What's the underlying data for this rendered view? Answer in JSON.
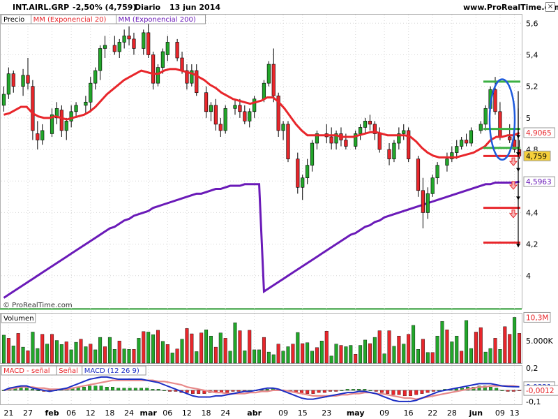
{
  "header": {
    "ticker": "INT.AIRL.GRP",
    "change": "-2,50% (4,759)",
    "period": "Diario",
    "date": "13 jun 2014",
    "site": "www.ProRealTime.com",
    "close_glyph": "×"
  },
  "watermark": "© ProRealTime.com",
  "colors": {
    "up": "#22a62a",
    "down": "#e8262b",
    "ema20": "#e8262b",
    "ema200": "#6a1ab8",
    "support": "#e8262b",
    "resistance": "#3cb043",
    "macd": "#1c2ec4",
    "signal": "#e88a8a",
    "ellipse": "#1e5adc",
    "grid": "#d6d6d6"
  },
  "chart_data": [
    {
      "type": "candlestick",
      "panel": "price",
      "legend": [
        "Precio",
        "MM (Exponencial 20)",
        "MM (Exponencial 200)"
      ],
      "y_ticks": [
        "5,6",
        "5,4",
        "5,2",
        "5",
        "4,8",
        "4,6",
        "4,4",
        "4,2",
        "4"
      ],
      "y_tick_values": [
        5.6,
        5.4,
        5.2,
        5.0,
        4.8,
        4.6,
        4.4,
        4.2,
        4.0
      ],
      "ylim": [
        3.8,
        5.65
      ],
      "x_ticks": [
        "21",
        "27",
        "feb",
        "06",
        "12",
        "18",
        "24",
        "mar",
        "06",
        "12",
        "18",
        "24",
        "abr",
        "09",
        "15",
        "23",
        "may",
        "09",
        "16",
        "22",
        "28",
        "jun",
        "09",
        "13"
      ],
      "x_tick_bars": [
        1,
        5,
        10,
        14,
        18,
        22,
        26,
        30,
        34,
        38,
        42,
        46,
        52,
        58,
        62,
        67,
        73,
        79,
        84,
        89,
        93,
        98,
        103,
        106
      ],
      "bars": 108,
      "candles_ohlc": [
        [
          5.08,
          5.2,
          5.04,
          5.15
        ],
        [
          5.15,
          5.32,
          5.12,
          5.28
        ],
        [
          5.28,
          5.3,
          5.16,
          5.2
        ],
        [
          5.2,
          5.31,
          5.14,
          5.27
        ],
        [
          5.27,
          5.38,
          5.18,
          5.22
        ],
        [
          5.2,
          5.24,
          4.86,
          4.92
        ],
        [
          4.9,
          4.98,
          4.8,
          4.86
        ],
        [
          4.86,
          4.96,
          4.83,
          4.92
        ],
        [
          4.9,
          5.06,
          4.88,
          5.02
        ],
        [
          5.0,
          5.1,
          4.96,
          5.06
        ],
        [
          5.05,
          5.08,
          4.88,
          4.92
        ],
        [
          4.92,
          5.0,
          4.86,
          4.98
        ],
        [
          4.98,
          5.08,
          4.94,
          5.04
        ],
        [
          5.04,
          5.1,
          5.0,
          5.08
        ],
        [
          5.08,
          5.14,
          5.02,
          5.1
        ],
        [
          5.1,
          5.26,
          5.04,
          5.22
        ],
        [
          5.22,
          5.32,
          5.18,
          5.3
        ],
        [
          5.3,
          5.46,
          5.24,
          5.44
        ],
        [
          5.44,
          5.52,
          5.38,
          5.46
        ],
        [
          5.46,
          5.52,
          5.4,
          5.42
        ],
        [
          5.42,
          5.5,
          5.38,
          5.48
        ],
        [
          5.48,
          5.56,
          5.44,
          5.52
        ],
        [
          5.52,
          5.58,
          5.46,
          5.5
        ],
        [
          5.5,
          5.54,
          5.4,
          5.44
        ],
        [
          5.44,
          5.56,
          5.4,
          5.54
        ],
        [
          5.54,
          5.6,
          5.38,
          5.4
        ],
        [
          5.4,
          5.42,
          5.18,
          5.22
        ],
        [
          5.22,
          5.34,
          5.2,
          5.32
        ],
        [
          5.32,
          5.44,
          5.28,
          5.42
        ],
        [
          5.4,
          5.52,
          5.36,
          5.48
        ],
        [
          5.48,
          5.5,
          5.36,
          5.38
        ],
        [
          5.38,
          5.42,
          5.28,
          5.3
        ],
        [
          5.3,
          5.34,
          5.18,
          5.22
        ],
        [
          5.22,
          5.34,
          5.2,
          5.3
        ],
        [
          5.3,
          5.34,
          5.14,
          5.16
        ],
        [
          5.16,
          5.2,
          5.0,
          5.04
        ],
        [
          5.04,
          5.1,
          4.98,
          5.08
        ],
        [
          5.08,
          5.12,
          4.92,
          4.96
        ],
        [
          4.96,
          5.0,
          4.88,
          4.92
        ],
        [
          4.92,
          5.08,
          4.9,
          5.06
        ],
        [
          5.06,
          5.12,
          5.02,
          5.08
        ],
        [
          5.08,
          5.12,
          5.0,
          5.04
        ],
        [
          5.04,
          5.08,
          4.96,
          4.98
        ],
        [
          4.98,
          5.06,
          4.94,
          5.04
        ],
        [
          5.04,
          5.14,
          5.0,
          5.12
        ],
        [
          5.12,
          5.24,
          5.1,
          5.22
        ],
        [
          5.22,
          5.36,
          5.2,
          5.34
        ],
        [
          5.34,
          5.44,
          5.1,
          5.14
        ],
        [
          5.14,
          5.16,
          4.88,
          4.92
        ],
        [
          4.92,
          4.98,
          4.86,
          4.96
        ],
        [
          4.96,
          4.98,
          4.72,
          4.74
        ],
        [
          4.74,
          4.78,
          4.52,
          4.56
        ],
        [
          4.56,
          4.64,
          4.48,
          4.62
        ],
        [
          4.62,
          4.74,
          4.58,
          4.7
        ],
        [
          4.7,
          4.86,
          4.66,
          4.84
        ],
        [
          4.84,
          4.92,
          4.8,
          4.9
        ],
        [
          4.9,
          4.96,
          4.84,
          4.88
        ],
        [
          4.88,
          4.94,
          4.8,
          4.84
        ],
        [
          4.84,
          4.92,
          4.8,
          4.9
        ],
        [
          4.9,
          4.94,
          4.82,
          4.86
        ],
        [
          4.86,
          4.9,
          4.8,
          4.82
        ],
        [
          4.82,
          4.92,
          4.8,
          4.9
        ],
        [
          4.9,
          4.96,
          4.86,
          4.94
        ],
        [
          4.94,
          5.0,
          4.9,
          4.98
        ],
        [
          4.98,
          5.02,
          4.92,
          4.96
        ],
        [
          4.96,
          4.98,
          4.86,
          4.9
        ],
        [
          4.9,
          4.94,
          4.78,
          4.8
        ],
        [
          4.8,
          4.84,
          4.7,
          4.74
        ],
        [
          4.74,
          4.86,
          4.72,
          4.84
        ],
        [
          4.84,
          4.94,
          4.8,
          4.9
        ],
        [
          4.9,
          4.96,
          4.86,
          4.92
        ],
        [
          4.92,
          4.94,
          4.72,
          4.74
        ],
        [
          4.74,
          4.76,
          4.5,
          4.54
        ],
        [
          4.54,
          4.62,
          4.3,
          4.4
        ],
        [
          4.4,
          4.56,
          4.36,
          4.52
        ],
        [
          4.52,
          4.64,
          4.5,
          4.62
        ],
        [
          4.62,
          4.72,
          4.58,
          4.7
        ],
        [
          4.7,
          4.78,
          4.66,
          4.74
        ],
        [
          4.74,
          4.82,
          4.72,
          4.78
        ],
        [
          4.78,
          4.86,
          4.74,
          4.82
        ],
        [
          4.82,
          4.88,
          4.8,
          4.86
        ],
        [
          4.86,
          4.9,
          4.82,
          4.84
        ],
        [
          4.84,
          4.94,
          4.82,
          4.92
        ],
        [
          4.92,
          4.98,
          4.9,
          4.96
        ],
        [
          4.96,
          5.08,
          4.92,
          5.06
        ],
        [
          5.06,
          5.2,
          5.04,
          5.18
        ],
        [
          5.18,
          5.26,
          5.02,
          5.04
        ],
        [
          5.04,
          5.1,
          4.86,
          4.88
        ],
        [
          4.88,
          4.96,
          4.84,
          4.86
        ],
        [
          4.86,
          4.92,
          4.78,
          4.8
        ],
        [
          4.8,
          4.86,
          4.74,
          4.76
        ]
      ],
      "ema20": [
        5.02,
        5.03,
        5.05,
        5.07,
        5.07,
        5.03,
        5.01,
        5.0,
        5.0,
        5.01,
        5.0,
        4.99,
        5.0,
        5.01,
        5.02,
        5.04,
        5.07,
        5.11,
        5.15,
        5.18,
        5.21,
        5.24,
        5.26,
        5.28,
        5.3,
        5.29,
        5.28,
        5.28,
        5.3,
        5.31,
        5.31,
        5.3,
        5.29,
        5.28,
        5.26,
        5.24,
        5.21,
        5.19,
        5.16,
        5.14,
        5.12,
        5.11,
        5.1,
        5.09,
        5.1,
        5.11,
        5.13,
        5.13,
        5.1,
        5.06,
        5.01,
        4.96,
        4.92,
        4.89,
        4.89,
        4.89,
        4.89,
        4.89,
        4.89,
        4.88,
        4.88,
        4.88,
        4.89,
        4.9,
        4.91,
        4.91,
        4.9,
        4.89,
        4.89,
        4.89,
        4.89,
        4.88,
        4.85,
        4.81,
        4.78,
        4.76,
        4.75,
        4.75,
        4.75,
        4.75,
        4.76,
        4.77,
        4.78,
        4.8,
        4.82,
        4.86,
        4.88,
        4.88,
        4.89,
        4.89,
        4.906
      ],
      "ema200": [
        3.86,
        3.88,
        3.9,
        3.92,
        3.94,
        3.96,
        3.98,
        4.0,
        4.02,
        4.04,
        4.06,
        4.08,
        4.1,
        4.12,
        4.14,
        4.16,
        4.18,
        4.2,
        4.22,
        4.24,
        4.26,
        4.27,
        4.29,
        4.31,
        4.32,
        4.34,
        4.35,
        4.37,
        4.38,
        4.39,
        4.4,
        4.41,
        4.42,
        4.43,
        4.44,
        4.45,
        4.46,
        4.47,
        4.48,
        4.49,
        4.5,
        4.51,
        4.52,
        4.53,
        4.54,
        4.55,
        4.56,
        4.57,
        4.58,
        4.58,
        4.59,
        4.59,
        4.59,
        4.59,
        4.59,
        4.596
      ],
      "ema200_start_bar": 53,
      "ema200_early": [
        3.86,
        3.88,
        3.9,
        3.92,
        3.94,
        3.96,
        3.98,
        4.0,
        4.02,
        4.04,
        4.06,
        4.08,
        4.1,
        4.12,
        4.14,
        4.16,
        4.18,
        4.2,
        4.22,
        4.24,
        4.26,
        4.28,
        4.3,
        4.31,
        4.33,
        4.35,
        4.36,
        4.38,
        4.39,
        4.4,
        4.41,
        4.43,
        4.44,
        4.45,
        4.46,
        4.47,
        4.48,
        4.49,
        4.5,
        4.51,
        4.52,
        4.52,
        4.53,
        4.54,
        4.55,
        4.55,
        4.56,
        4.57,
        4.57,
        4.57,
        4.58,
        4.58,
        4.58,
        4.58
      ],
      "support_levels": [
        4.759,
        4.43,
        4.21
      ],
      "resistance_levels": [
        5.23,
        4.93,
        4.81
      ],
      "last_values": {
        "ema20": "4,9065",
        "close": "4,759",
        "ema200": "4,5963"
      }
    },
    {
      "type": "bar",
      "panel": "volume",
      "title": "Volumen",
      "y_ticks": [
        "10,3M",
        "5.000K"
      ],
      "y_tick_values": [
        10.3,
        5.0
      ],
      "ylim": [
        0,
        11
      ],
      "values_millions": [
        6.3,
        5.6,
        3.9,
        6.7,
        3.6,
        2.8,
        7.0,
        3.3,
        6.5,
        4.3,
        6.5,
        5.1,
        4.2,
        4.8,
        3.0,
        4.7,
        5.4,
        3.7,
        4.3,
        3.0,
        5.8,
        3.7,
        5.8,
        3.1,
        5.0,
        3.2,
        3.1,
        3.1,
        5.6,
        7.1,
        7.0,
        6.4,
        7.4,
        4.9,
        4.2,
        2.3,
        3.2,
        5.4,
        7.8,
        6.6,
        2.6,
        6.8,
        7.5,
        6.1,
        3.6,
        6.8,
        5.6,
        2.7,
        9.1,
        7.3,
        2.8,
        7.4,
        3.0,
        3.0,
        5.8,
        2.5,
        1.9,
        4.3,
        2.7,
        3.7,
        4.3,
        6.9,
        4.4,
        4.6,
        2.7,
        3.5,
        5.0,
        7.2,
        1.6,
        4.3,
        4.0,
        3.7,
        4.0,
        2.0,
        4.0,
        5.2,
        4.4,
        5.8,
        7.3,
        2.1,
        7.3,
        3.8,
        6.1,
        4.3,
        6.5,
        8.5,
        3.1,
        5.4,
        2.4,
        2.4,
        6.1,
        9.4,
        7.5,
        4.8,
        6.1,
        2.7,
        9.6,
        3.3,
        7.0,
        8.0,
        2.5,
        3.3,
        5.6,
        3.1,
        8.2,
        6.5,
        10.3,
        6.7
      ],
      "colors_up": [
        1,
        0,
        1,
        0,
        1,
        0,
        1,
        1,
        0,
        1,
        0,
        1,
        1,
        0,
        1,
        1,
        0,
        1,
        0,
        1,
        1,
        0,
        1,
        1,
        0,
        1,
        1,
        0,
        1,
        0,
        1,
        1,
        0,
        1,
        0,
        1,
        0,
        1,
        0,
        0,
        1,
        0,
        1,
        1,
        0,
        1,
        0,
        1,
        1,
        0,
        1,
        0,
        1,
        1,
        0,
        1,
        1,
        0,
        1,
        1,
        0,
        1,
        0,
        1,
        1,
        0,
        1,
        0,
        1,
        1,
        0,
        1,
        1,
        0,
        1,
        1,
        0,
        1,
        0,
        1,
        0,
        1,
        0,
        1,
        0,
        1,
        1,
        0,
        1,
        0,
        1,
        1,
        0,
        1,
        1,
        0,
        1,
        1,
        0,
        0,
        1,
        1,
        0,
        1,
        0,
        0,
        1,
        0
      ]
    },
    {
      "type": "line",
      "panel": "macd",
      "legend": [
        "MACD - señal",
        "Señal",
        "MACD (12 26 9)"
      ],
      "y_ticks": [
        "0,2",
        "0,0322",
        "0,0321",
        "-0,0012",
        "-0,1"
      ],
      "y_tick_values": [
        0.2,
        0.0322,
        0.0321,
        -0.0012,
        -0.1
      ],
      "ylim": [
        -0.12,
        0.22
      ],
      "histogram": [
        0.0,
        0.01,
        0.02,
        0.03,
        0.02,
        0.01,
        0.0,
        -0.01,
        -0.01,
        0.0,
        0.01,
        0.02,
        0.02,
        0.03,
        0.03,
        0.04,
        0.04,
        0.04,
        0.03,
        0.03,
        0.02,
        0.02,
        0.02,
        0.02,
        0.02,
        0.02,
        0.01,
        0.01,
        0.0,
        -0.01,
        -0.01,
        -0.02,
        -0.02,
        -0.03,
        -0.03,
        -0.03,
        -0.02,
        -0.02,
        -0.02,
        -0.02,
        -0.01,
        -0.01,
        -0.01,
        0.0,
        0.0,
        0.01,
        0.01,
        0.02,
        0.01,
        0.0,
        -0.01,
        -0.02,
        -0.03,
        -0.03,
        -0.03,
        -0.02,
        -0.02,
        -0.01,
        -0.01,
        0.0,
        0.01,
        0.01,
        0.01,
        0.01,
        0.0,
        -0.01,
        -0.02,
        -0.03,
        -0.04,
        -0.04,
        -0.05,
        -0.05,
        -0.04,
        -0.03,
        -0.02,
        -0.01,
        0.0,
        0.01,
        0.01,
        0.02,
        0.02,
        0.03,
        0.03,
        0.04,
        0.04,
        0.03,
        0.02,
        0.0,
        -0.01,
        -0.01,
        -0.0012
      ],
      "macd": [
        0.0,
        0.02,
        0.03,
        0.04,
        0.04,
        0.02,
        0.01,
        0.0,
        -0.01,
        0.0,
        0.01,
        0.02,
        0.04,
        0.06,
        0.08,
        0.1,
        0.11,
        0.12,
        0.12,
        0.11,
        0.1,
        0.1,
        0.1,
        0.1,
        0.1,
        0.09,
        0.08,
        0.07,
        0.05,
        0.03,
        0.01,
        -0.01,
        -0.03,
        -0.05,
        -0.06,
        -0.06,
        -0.06,
        -0.05,
        -0.05,
        -0.04,
        -0.03,
        -0.02,
        -0.01,
        -0.01,
        0.0,
        0.01,
        0.02,
        0.02,
        0.01,
        -0.01,
        -0.03,
        -0.05,
        -0.07,
        -0.08,
        -0.08,
        -0.07,
        -0.06,
        -0.05,
        -0.04,
        -0.03,
        -0.02,
        -0.02,
        -0.01,
        -0.01,
        -0.02,
        -0.03,
        -0.05,
        -0.07,
        -0.09,
        -0.1,
        -0.1,
        -0.1,
        -0.09,
        -0.07,
        -0.05,
        -0.03,
        -0.01,
        0.0,
        0.01,
        0.02,
        0.03,
        0.04,
        0.05,
        0.06,
        0.06,
        0.06,
        0.05,
        0.04,
        0.035,
        0.033,
        0.0321
      ],
      "signal": [
        0.0,
        0.01,
        0.02,
        0.03,
        0.03,
        0.03,
        0.02,
        0.02,
        0.01,
        0.01,
        0.01,
        0.01,
        0.02,
        0.03,
        0.04,
        0.05,
        0.06,
        0.07,
        0.08,
        0.09,
        0.09,
        0.09,
        0.09,
        0.09,
        0.09,
        0.09,
        0.09,
        0.08,
        0.08,
        0.07,
        0.06,
        0.05,
        0.03,
        0.02,
        0.01,
        0.0,
        -0.01,
        -0.02,
        -0.02,
        -0.03,
        -0.03,
        -0.03,
        -0.03,
        -0.02,
        -0.02,
        -0.01,
        -0.01,
        0.0,
        0.0,
        0.0,
        -0.01,
        -0.02,
        -0.03,
        -0.04,
        -0.05,
        -0.05,
        -0.05,
        -0.05,
        -0.05,
        -0.04,
        -0.04,
        -0.03,
        -0.03,
        -0.02,
        -0.02,
        -0.03,
        -0.03,
        -0.04,
        -0.05,
        -0.06,
        -0.07,
        -0.07,
        -0.08,
        -0.07,
        -0.06,
        -0.05,
        -0.04,
        -0.03,
        -0.02,
        -0.01,
        0.0,
        0.01,
        0.02,
        0.03,
        0.03,
        0.04,
        0.04,
        0.04,
        0.04,
        0.04,
        0.0322
      ]
    }
  ]
}
